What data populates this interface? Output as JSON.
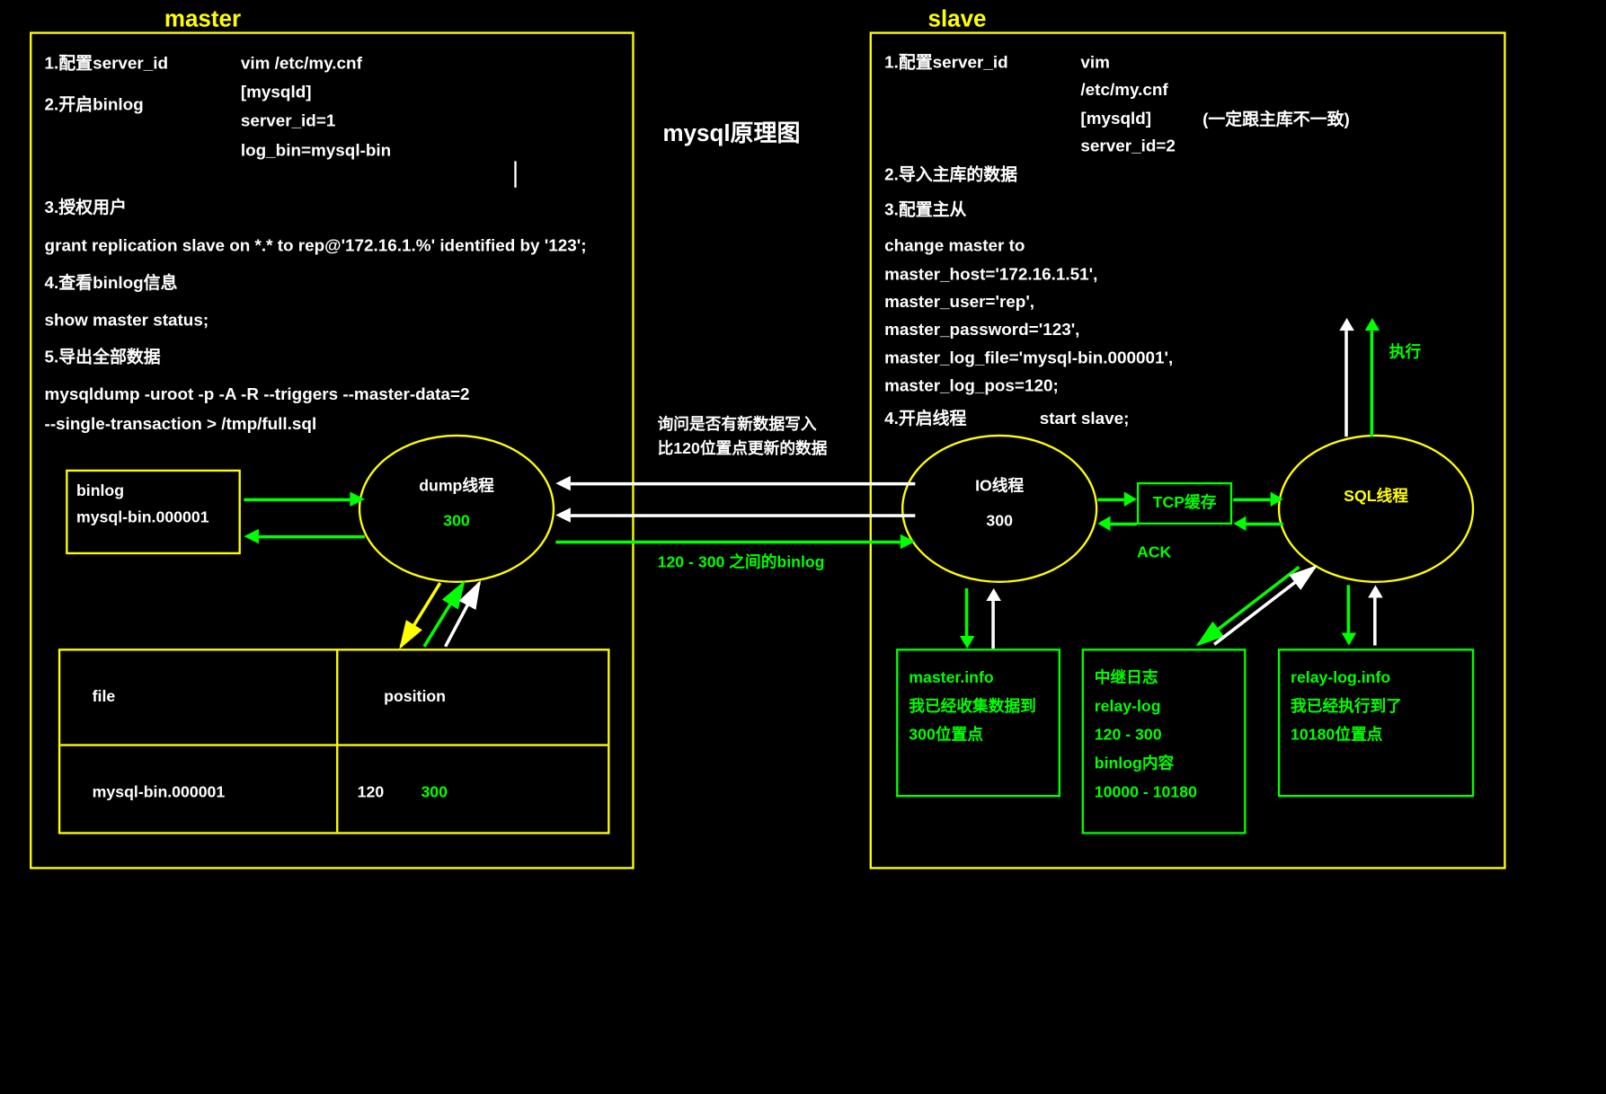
{
  "titles": {
    "master": "master",
    "slave": "slave",
    "center": "mysql原理图"
  },
  "master": {
    "step1": "1.配置server_id",
    "step2": "2.开启binlog",
    "cfg1": "vim /etc/my.cnf",
    "cfg2": "[mysqld]",
    "cfg3": "server_id=1",
    "cfg4": "log_bin=mysql-bin",
    "step3": "3.授权用户",
    "grant": "grant replication slave on *.* to rep@'172.16.1.%' identified by '123';",
    "step4": "4.查看binlog信息",
    "show": "show master status;",
    "step5": "5.导出全部数据",
    "dump1": "mysqldump -uroot -p -A -R --triggers --master-data=2",
    "dump2": "--single-transaction > /tmp/full.sql"
  },
  "slave": {
    "step1": "1.配置server_id",
    "cfg1": "vim /etc/my.cnf",
    "cfg2": "[mysqld]",
    "cfg3": "server_id=2",
    "note": "(一定跟主库不一致)",
    "step2": "2.导入主库的数据",
    "step3": "3.配置主从",
    "cm1": "change master to",
    "cm2": "master_host='172.16.1.51',",
    "cm3": "master_user='rep',",
    "cm4": "master_password='123',",
    "cm5": "master_log_file='mysql-bin.000001',",
    "cm6": "master_log_pos=120;",
    "step4": "4.开启线程",
    "start": "start slave;"
  },
  "binlog_box": {
    "label": "binlog",
    "file": "mysql-bin.000001"
  },
  "threads": {
    "dump": "dump线程",
    "dump_val": "300",
    "io": "IO线程",
    "io_val": "300",
    "sql": "SQL线程",
    "tcp": "TCP缓存",
    "ack": "ACK"
  },
  "table": {
    "h1": "file",
    "h2": "position",
    "c1": "mysql-bin.000001",
    "c2a": "120",
    "c2b": "300"
  },
  "between": {
    "q1": "询问是否有新数据写入",
    "q2": "比120位置点更新的数据",
    "range": "120 - 300 之间的binlog",
    "exec": "执行"
  },
  "master_info": {
    "l1": "master.info",
    "l2": "我已经收集数据到",
    "l3": "300位置点"
  },
  "relay_log": {
    "l1": "中继日志",
    "l2": "relay-log",
    "l3": "120 - 300",
    "l4": "binlog内容",
    "l5": "10000 - 10180"
  },
  "relay_info": {
    "l1": "relay-log.info",
    "l2": "我已经执行到了",
    "l3": "10180位置点"
  }
}
